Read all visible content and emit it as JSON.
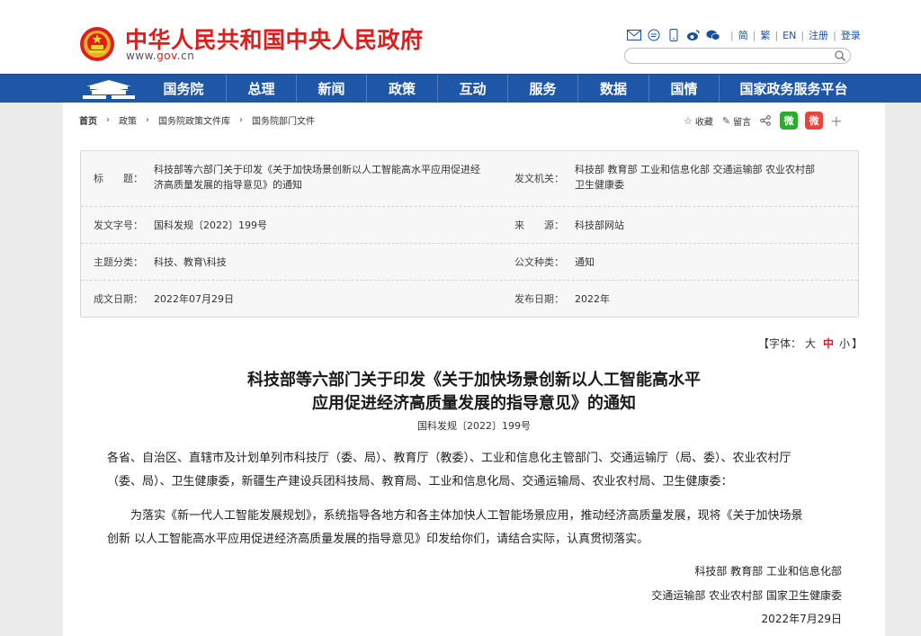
{
  "header": {
    "site_title": "中华人民共和国中央人民政府",
    "url_prefix": "www.",
    "url_accent": "gov",
    "url_suffix": ".cn",
    "lang_simplified": "简",
    "lang_traditional": "繁",
    "lang_english": "EN",
    "register": "注册",
    "login": "登录",
    "search_placeholder": ""
  },
  "nav": {
    "items": [
      "国务院",
      "总理",
      "新闻",
      "政策",
      "互动",
      "服务",
      "数据",
      "国情",
      "国家政务服务平台"
    ]
  },
  "breadcrumb": [
    "首页",
    "政策",
    "国务院政策文件库",
    "国务院部门文件"
  ],
  "tools": {
    "favorite": "收藏",
    "comment": "留言",
    "wechat": "微",
    "weibo": "微",
    "more": "+"
  },
  "meta": {
    "title_label": "标　　题：",
    "title_value_line1": "科技部等六部门关于印发《关于加快场景创新以人工智能高水平应用促进经",
    "title_value_line2": "济高质量发展的指导意见》的通知",
    "issuer_label": "发文机关：",
    "issuer_value_line1": "科技部  教育部  工业和信息化部  交通运输部  农业农村部",
    "issuer_value_line2": "卫生健康委",
    "doc_no_label": "发文字号：",
    "doc_no_value": "国科发规〔2022〕199号",
    "source_label": "来　　源：",
    "source_value": "科技部网站",
    "topic_label": "主题分类：",
    "topic_value": "科技、教育\\科技",
    "genre_label": "公文种类：",
    "genre_value": "通知",
    "written_label": "成文日期：",
    "written_value": "2022年07月29日",
    "published_label": "发布日期：",
    "published_value": "2022年"
  },
  "font_size": {
    "prefix": "【字体：",
    "big": "大",
    "mid": "中",
    "small": "小",
    "suffix": "】"
  },
  "article": {
    "title_line1": "科技部等六部门关于印发《关于加快场景创新以人工智能高水平",
    "title_line2": "应用促进经济高质量发展的指导意见》的通知",
    "doc_no": "国科发规〔2022〕199号",
    "para1_line1": "各省、自治区、直辖市及计划单列市科技厅（委、局）、教育厅（教委）、工业和信息化主管部门、交通运输厅（局、委）、农业农村厅",
    "para1_line2": "（委、局）、卫生健康委，新疆生产建设兵团科技局、教育局、工业和信息化局、交通运输局、农业农村局、卫生健康委：",
    "para2_line1": "为落实《新一代人工智能发展规划》，系统指导各地方和各主体加快人工智能场景应用，推动经济高质量发展，现将《关于加快场景",
    "para2_line2": "创新  以人工智能高水平应用促进经济高质量发展的指导意见》印发给你们，请结合实际，认真贯彻落实。",
    "sign_line1": "科技部  教育部  工业和信息化部",
    "sign_line2": "交通运输部  农业农村部  国家卫生健康委",
    "sign_date": "2022年7月29日"
  },
  "colors": {
    "brand_red": "#d91f1f",
    "nav_blue": "#1e57a8"
  }
}
